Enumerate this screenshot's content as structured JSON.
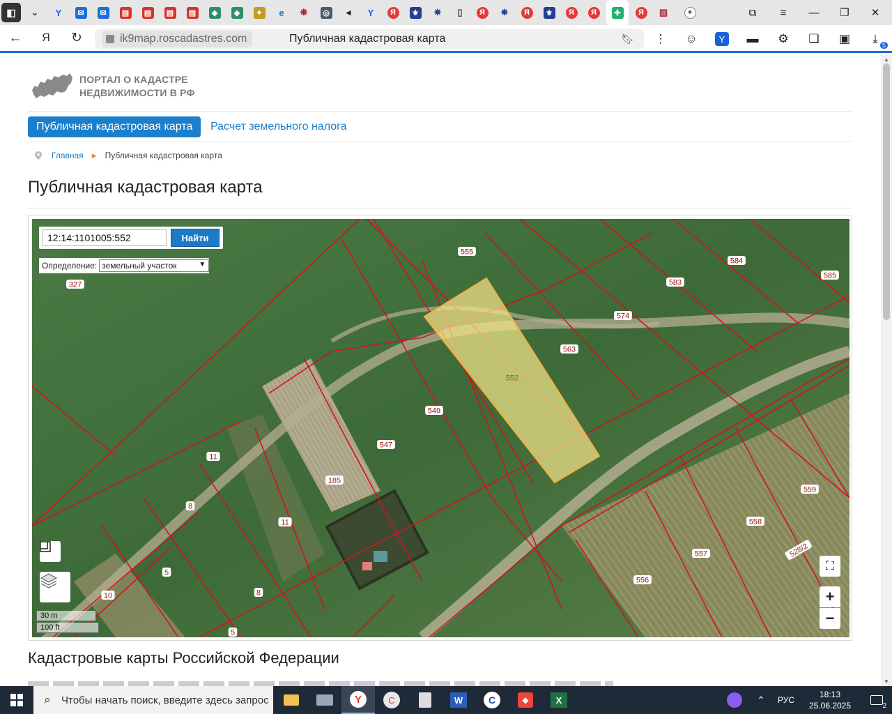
{
  "browser": {
    "url_host": "ik9map.roscadastres.com",
    "page_title": "Публичная кадастровая карта",
    "tab_count_badge": "5",
    "tab_icons": [
      "sound-icon",
      "dropdown-icon",
      "yandex-y-icon",
      "mail-icon",
      "mail-icon",
      "pdf-icon",
      "pdf-icon",
      "pdf-icon",
      "pdf-icon",
      "emblem-icon",
      "emblem-icon",
      "emblem-icon",
      "edge-icon",
      "ornament-icon",
      "camera-icon",
      "audio-icon",
      "yandex-y-icon",
      "yandex-icon",
      "emblem-icon",
      "eagle-icon",
      "document-icon",
      "yandex-icon",
      "eagle-icon",
      "yandex-icon",
      "emblem-icon",
      "yandex-icon",
      "yandex-icon",
      "active-tab-icon",
      "yandex-icon",
      "audio-wave-icon"
    ]
  },
  "site": {
    "logo_line1": "ПОРТАЛ О КАДАСТРЕ",
    "logo_line2": "НЕДВИЖИМОСТИ В РФ",
    "menu_active": "Публичная кадастровая карта",
    "menu_link": "Расчет земельного налога",
    "breadcrumb_home": "Главная",
    "breadcrumb_current": "Публичная кадастровая карта",
    "page_heading": "Публичная кадастровая карта",
    "section_heading": "Кадастровые карты Российской Федерации"
  },
  "map": {
    "search_value": "12:14:1101005:552",
    "search_button": "Найти",
    "definition_label": "Определение:",
    "definition_value": "земельный участок",
    "scale_metric": "30 m",
    "scale_imperial": "100 ft",
    "zoom_in": "+",
    "zoom_out": "−",
    "selected_parcel": "552",
    "parcel_labels": [
      "555",
      "327",
      "584",
      "585",
      "583",
      "574",
      "563",
      "552",
      "549",
      "547",
      "185",
      "11",
      "8",
      "11",
      "5",
      "8",
      "10",
      "5",
      "559",
      "558",
      "528/2",
      "557",
      "556"
    ],
    "colors": {
      "parcel_border": "#d3131a",
      "selected_fill": "#f3e38a",
      "selected_stroke": "#f0b040",
      "accent": "#1b7fcc"
    }
  },
  "taskbar": {
    "search_placeholder": "Чтобы начать поиск, введите здесь запрос",
    "language": "РУС",
    "time": "18:13",
    "date": "25.06.2025",
    "notifications": "2"
  }
}
